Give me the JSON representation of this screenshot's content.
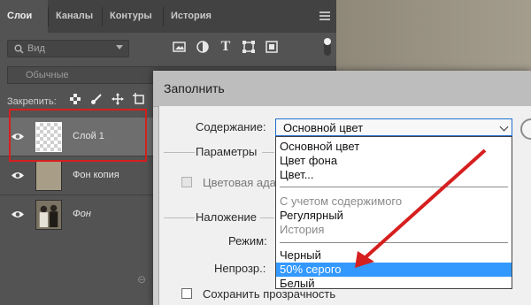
{
  "panel": {
    "tabs": [
      "Слои",
      "Каналы",
      "Контуры",
      "История"
    ],
    "filter": {
      "placeholder": "Вид"
    },
    "blend_mode": "Обычные",
    "lock_label": "Закрепить:",
    "layers": [
      {
        "name": "Слой 1",
        "selected": true
      },
      {
        "name": "Фон копия",
        "selected": false
      },
      {
        "name": "Фон",
        "selected": false
      }
    ]
  },
  "dialog": {
    "title": "Заполнить",
    "content_label": "Содержание:",
    "content_value": "Основной цвет",
    "params_label": "Параметры",
    "color_adapt_label": "Цветовая ада",
    "blending_label": "Наложение",
    "mode_label": "Режим:",
    "opacity_label": "Непрозр.:",
    "preserve_label": "Сохранить прозрачность",
    "dropdown_options": [
      {
        "label": "Основной цвет",
        "state": "normal"
      },
      {
        "label": "Цвет фона",
        "state": "normal"
      },
      {
        "label": "Цвет...",
        "state": "normal"
      },
      {
        "label": "С учетом содержимого",
        "state": "disabled"
      },
      {
        "label": "Регулярный",
        "state": "normal"
      },
      {
        "label": "История",
        "state": "disabled"
      },
      {
        "label": "Черный",
        "state": "normal"
      },
      {
        "label": "50% серого",
        "state": "highlighted"
      },
      {
        "label": "Белый",
        "state": "normal"
      }
    ]
  },
  "colors": {
    "highlight": "#3399ff",
    "annotation_red": "#d61f1f",
    "panel_bg": "#535353"
  }
}
